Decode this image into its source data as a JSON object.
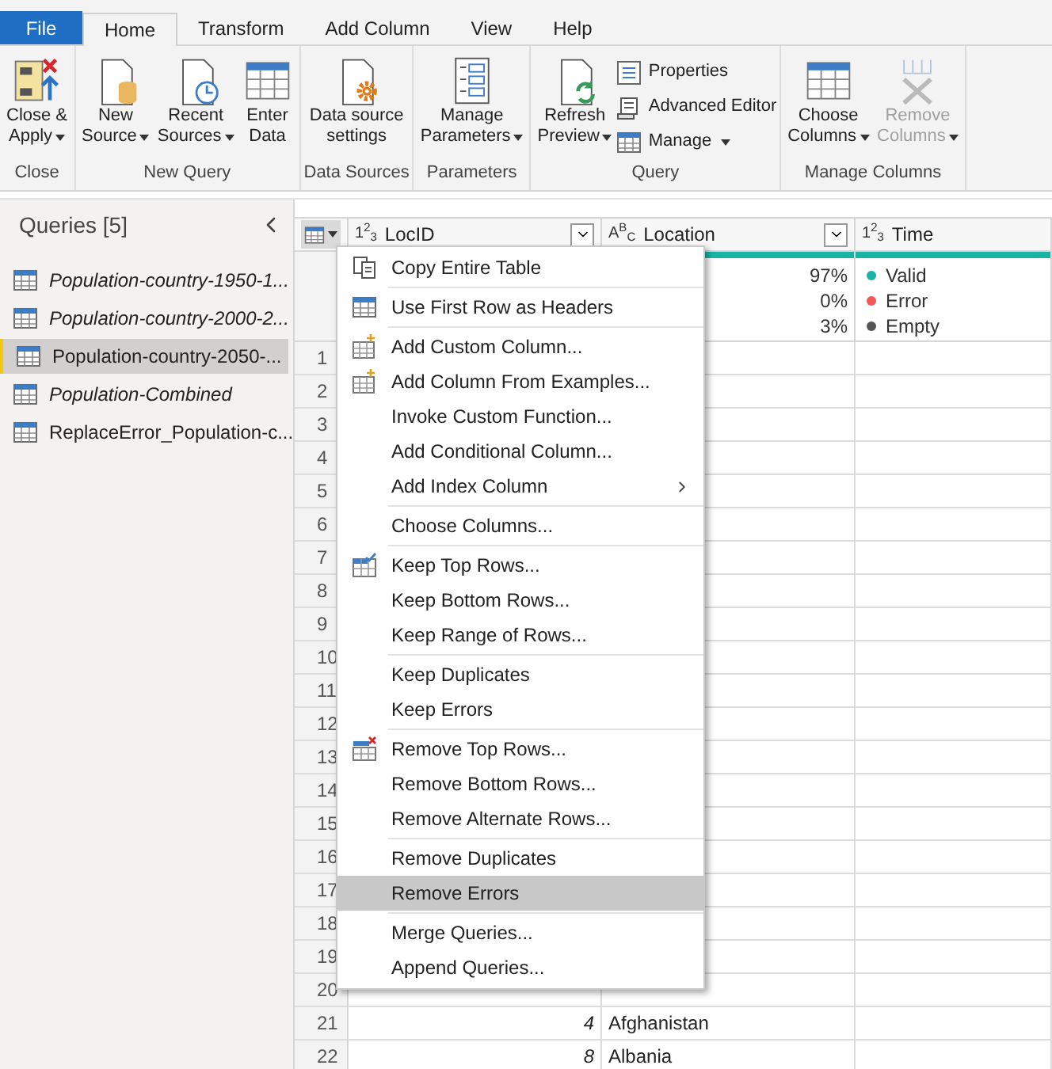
{
  "ribbon_tabs": [
    {
      "label": "File",
      "kind": "file",
      "selected": false
    },
    {
      "label": "Home",
      "kind": "tab",
      "selected": true
    },
    {
      "label": "Transform",
      "kind": "tab",
      "selected": false
    },
    {
      "label": "Add Column",
      "kind": "tab",
      "selected": false
    },
    {
      "label": "View",
      "kind": "tab",
      "selected": false
    },
    {
      "label": "Help",
      "kind": "tab",
      "selected": false
    }
  ],
  "ribbon_groups": [
    {
      "label": "Close",
      "buttons": [
        {
          "kind": "large",
          "lines": [
            "Close &",
            "Apply"
          ],
          "dropdown": true,
          "disabled": false
        }
      ]
    },
    {
      "label": "New Query",
      "buttons": [
        {
          "kind": "large",
          "lines": [
            "New",
            "Source"
          ],
          "dropdown": true,
          "disabled": false
        },
        {
          "kind": "large",
          "lines": [
            "Recent",
            "Sources"
          ],
          "dropdown": true,
          "disabled": false
        },
        {
          "kind": "large",
          "lines": [
            "Enter",
            "Data"
          ],
          "dropdown": false,
          "disabled": false
        }
      ]
    },
    {
      "label": "Data Sources",
      "buttons": [
        {
          "kind": "large",
          "lines": [
            "Data source",
            "settings"
          ],
          "dropdown": false,
          "disabled": false
        }
      ]
    },
    {
      "label": "Parameters",
      "buttons": [
        {
          "kind": "large",
          "lines": [
            "Manage",
            "Parameters"
          ],
          "dropdown": true,
          "disabled": false
        }
      ]
    },
    {
      "label": "Query",
      "buttons": [
        {
          "kind": "large",
          "lines": [
            "Refresh",
            "Preview"
          ],
          "dropdown": true,
          "disabled": false
        },
        {
          "kind": "small",
          "lines": [
            "Properties"
          ],
          "dropdown": false,
          "disabled": false
        },
        {
          "kind": "small",
          "lines": [
            "Advanced Editor"
          ],
          "dropdown": false,
          "disabled": false
        },
        {
          "kind": "small",
          "lines": [
            "Manage"
          ],
          "dropdown": true,
          "disabled": false
        }
      ]
    },
    {
      "label": "Manage Columns",
      "buttons": [
        {
          "kind": "large",
          "lines": [
            "Choose",
            "Columns"
          ],
          "dropdown": true,
          "disabled": false
        },
        {
          "kind": "large",
          "lines": [
            "Remove",
            "Columns"
          ],
          "dropdown": true,
          "disabled": true
        }
      ]
    }
  ],
  "queries_pane": {
    "title": "Queries [5]",
    "items": [
      {
        "label": "Population-country-1950-1...",
        "loaded": false,
        "selected": false
      },
      {
        "label": "Population-country-2000-2...",
        "loaded": false,
        "selected": false
      },
      {
        "label": "Population-country-2050-...",
        "loaded": true,
        "selected": true
      },
      {
        "label": "Population-Combined",
        "loaded": false,
        "selected": false
      },
      {
        "label": "ReplaceError_Population-c...",
        "loaded": true,
        "selected": false
      }
    ]
  },
  "table": {
    "columns": [
      {
        "type_icon": "1$^{2}$$_{3}$",
        "name": "LocID"
      },
      {
        "type_icon": "A$^{B}$$_{C}$",
        "name": "Location",
        "quality_values": [
          "97%",
          "0%",
          "3%"
        ]
      },
      {
        "type_icon": "1$^{2}$$_{3}$",
        "name": "Time",
        "quality_legend": [
          {
            "label": "Valid",
            "color": "#1ab4a6"
          },
          {
            "label": "Error",
            "color": "#f0585a"
          },
          {
            "label": "Empty",
            "color": "#555555"
          }
        ]
      }
    ],
    "rows": [
      {
        "number": "1"
      },
      {
        "number": "2"
      },
      {
        "number": "3"
      },
      {
        "number": "4"
      },
      {
        "number": "5"
      },
      {
        "number": "6"
      },
      {
        "number": "7"
      },
      {
        "number": "8"
      },
      {
        "number": "9"
      },
      {
        "number": "10"
      },
      {
        "number": "11"
      },
      {
        "number": "12"
      },
      {
        "number": "13"
      },
      {
        "number": "14"
      },
      {
        "number": "15"
      },
      {
        "number": "16"
      },
      {
        "number": "17"
      },
      {
        "number": "18"
      },
      {
        "number": "19"
      },
      {
        "number": "20"
      },
      {
        "number": "21",
        "cells": [
          "4",
          "Afghanistan"
        ]
      },
      {
        "number": "22",
        "cells": [
          "8",
          "Albania"
        ]
      }
    ]
  },
  "context_menu": {
    "groups": [
      [
        {
          "label": "Copy Entire Table",
          "selected": false,
          "submenu": false
        }
      ],
      [
        {
          "label": "Use First Row as Headers",
          "selected": false,
          "submenu": false
        }
      ],
      [
        {
          "label": "Add Custom Column...",
          "selected": false,
          "submenu": false
        },
        {
          "label": "Add Column From Examples...",
          "selected": false,
          "submenu": false
        },
        {
          "label": "Invoke Custom Function...",
          "selected": false,
          "submenu": false
        },
        {
          "label": "Add Conditional Column...",
          "selected": false,
          "submenu": false
        },
        {
          "label": "Add Index Column",
          "selected": false,
          "submenu": true
        }
      ],
      [
        {
          "label": "Choose Columns...",
          "selected": false,
          "submenu": false
        }
      ],
      [
        {
          "label": "Keep Top Rows...",
          "selected": false,
          "submenu": false
        },
        {
          "label": "Keep Bottom Rows...",
          "selected": false,
          "submenu": false
        },
        {
          "label": "Keep Range of Rows...",
          "selected": false,
          "submenu": false
        }
      ],
      [
        {
          "label": "Keep Duplicates",
          "selected": false,
          "submenu": false
        },
        {
          "label": "Keep Errors",
          "selected": false,
          "submenu": false
        }
      ],
      [
        {
          "label": "Remove Top Rows...",
          "selected": false,
          "submenu": false
        },
        {
          "label": "Remove Bottom Rows...",
          "selected": false,
          "submenu": false
        },
        {
          "label": "Remove Alternate Rows...",
          "selected": false,
          "submenu": false
        }
      ],
      [
        {
          "label": "Remove Duplicates",
          "selected": false,
          "submenu": false
        },
        {
          "label": "Remove Errors",
          "selected": true,
          "submenu": false
        }
      ],
      [
        {
          "label": "Merge Queries...",
          "selected": false,
          "submenu": false
        },
        {
          "label": "Append Queries...",
          "selected": false,
          "submenu": false
        }
      ]
    ]
  }
}
